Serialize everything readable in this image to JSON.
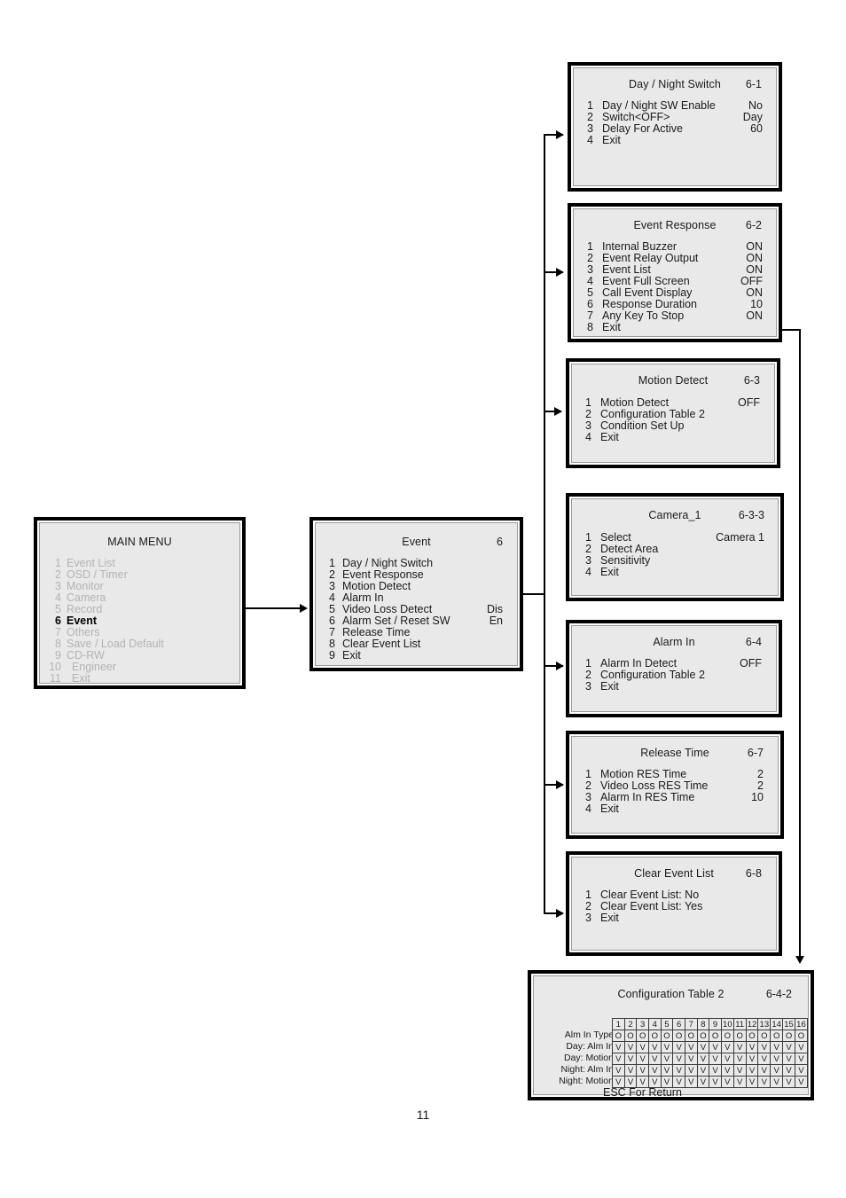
{
  "page": {
    "number": "11"
  },
  "panels": {
    "main_menu": {
      "title": "MAIN MENU",
      "code": "",
      "items": [
        {
          "num": "1",
          "label": "Event List",
          "value": "",
          "active": false
        },
        {
          "num": "2",
          "label": "OSD / Timer",
          "value": "",
          "active": false
        },
        {
          "num": "3",
          "label": "Monitor",
          "value": "",
          "active": false
        },
        {
          "num": "4",
          "label": "Camera",
          "value": "",
          "active": false
        },
        {
          "num": "5",
          "label": "Record",
          "value": "",
          "active": false
        },
        {
          "num": "6",
          "label": "Event",
          "value": "",
          "active": true
        },
        {
          "num": "7",
          "label": "Others",
          "value": "",
          "active": false
        },
        {
          "num": "8",
          "label": "Save / Load Default",
          "value": "",
          "active": false
        },
        {
          "num": "9",
          "label": "CD-RW",
          "value": "",
          "active": false
        },
        {
          "num": "10",
          "label": "Engineer",
          "value": "",
          "active": false
        },
        {
          "num": "11",
          "label": "Exit",
          "value": "",
          "active": false
        }
      ]
    },
    "event": {
      "title": "Event",
      "code": "6",
      "items": [
        {
          "num": "1",
          "label": "Day / Night Switch",
          "value": ""
        },
        {
          "num": "2",
          "label": "Event Response",
          "value": ""
        },
        {
          "num": "3",
          "label": "Motion Detect",
          "value": ""
        },
        {
          "num": "4",
          "label": "Alarm In",
          "value": ""
        },
        {
          "num": "5",
          "label": "Video Loss Detect",
          "value": "Dis"
        },
        {
          "num": "6",
          "label": "Alarm Set / Reset SW",
          "value": "En"
        },
        {
          "num": "7",
          "label": "Release Time",
          "value": ""
        },
        {
          "num": "8",
          "label": "Clear Event List",
          "value": ""
        },
        {
          "num": "9",
          "label": "Exit",
          "value": ""
        }
      ]
    },
    "day_night_switch": {
      "title": "Day / Night Switch",
      "code": "6-1",
      "items": [
        {
          "num": "1",
          "label": "Day / Night SW Enable",
          "value": "No"
        },
        {
          "num": "2",
          "label": "Switch<OFF>",
          "value": "Day"
        },
        {
          "num": "3",
          "label": "Delay For Active",
          "value": "60"
        },
        {
          "num": "4",
          "label": "Exit",
          "value": ""
        }
      ]
    },
    "event_response": {
      "title": "Event Response",
      "code": "6-2",
      "items": [
        {
          "num": "1",
          "label": "Internal Buzzer",
          "value": "ON"
        },
        {
          "num": "2",
          "label": "Event Relay Output",
          "value": "ON"
        },
        {
          "num": "3",
          "label": "Event List",
          "value": "ON"
        },
        {
          "num": "4",
          "label": "Event Full Screen",
          "value": "OFF"
        },
        {
          "num": "5",
          "label": "Call Event Display",
          "value": "ON"
        },
        {
          "num": "6",
          "label": "Response Duration",
          "value": "10"
        },
        {
          "num": "7",
          "label": "Any Key To Stop",
          "value": "ON"
        },
        {
          "num": "8",
          "label": "Exit",
          "value": ""
        }
      ]
    },
    "motion_detect": {
      "title": "Motion Detect",
      "code": "6-3",
      "items": [
        {
          "num": "1",
          "label": "Motion Detect",
          "value": "OFF"
        },
        {
          "num": "2",
          "label": "Configuration Table 2",
          "value": ""
        },
        {
          "num": "3",
          "label": "Condition Set Up",
          "value": ""
        },
        {
          "num": "4",
          "label": "Exit",
          "value": ""
        }
      ]
    },
    "camera_1": {
      "title": "Camera_1",
      "code": "6-3-3",
      "items": [
        {
          "num": "1",
          "label": "Select",
          "value": "Camera 1"
        },
        {
          "num": "2",
          "label": "Detect Area",
          "value": ""
        },
        {
          "num": "3",
          "label": "Sensitivity",
          "value": ""
        },
        {
          "num": "4",
          "label": "Exit",
          "value": ""
        }
      ]
    },
    "alarm_in": {
      "title": "Alarm In",
      "code": "6-4",
      "items": [
        {
          "num": "1",
          "label": "Alarm In Detect",
          "value": "OFF"
        },
        {
          "num": "2",
          "label": "Configuration Table 2",
          "value": ""
        },
        {
          "num": "3",
          "label": "Exit",
          "value": ""
        }
      ]
    },
    "release_time": {
      "title": "Release Time",
      "code": "6-7",
      "items": [
        {
          "num": "1",
          "label": "Motion RES Time",
          "value": "2"
        },
        {
          "num": "2",
          "label": "Video Loss RES Time",
          "value": "2"
        },
        {
          "num": "3",
          "label": "Alarm In RES Time",
          "value": "10"
        },
        {
          "num": "4",
          "label": "Exit",
          "value": ""
        }
      ]
    },
    "clear_event_list": {
      "title": "Clear Event List",
      "code": "6-8",
      "items": [
        {
          "num": "1",
          "label": "Clear Event List: No",
          "value": ""
        },
        {
          "num": "2",
          "label": "Clear Event List: Yes",
          "value": ""
        },
        {
          "num": "3",
          "label": "Exit",
          "value": ""
        }
      ]
    },
    "configuration_table_2": {
      "title": "Configuration Table 2",
      "code": "6-4-2",
      "footer": "ESC For Return",
      "columns": [
        "1",
        "2",
        "3",
        "4",
        "5",
        "6",
        "7",
        "8",
        "9",
        "10",
        "11",
        "12",
        "13",
        "14",
        "15",
        "16"
      ],
      "rows": [
        {
          "label": "Alm In Type",
          "cells": [
            "O",
            "O",
            "O",
            "O",
            "O",
            "O",
            "O",
            "O",
            "O",
            "O",
            "O",
            "O",
            "O",
            "O",
            "O",
            "O"
          ]
        },
        {
          "label": "Day: Alm In",
          "cells": [
            "V",
            "V",
            "V",
            "V",
            "V",
            "V",
            "V",
            "V",
            "V",
            "V",
            "V",
            "V",
            "V",
            "V",
            "V",
            "V"
          ]
        },
        {
          "label": "Day: Motion",
          "cells": [
            "V",
            "V",
            "V",
            "V",
            "V",
            "V",
            "V",
            "V",
            "V",
            "V",
            "V",
            "V",
            "V",
            "V",
            "V",
            "V"
          ]
        },
        {
          "label": "Night: Alm In",
          "cells": [
            "V",
            "V",
            "V",
            "V",
            "V",
            "V",
            "V",
            "V",
            "V",
            "V",
            "V",
            "V",
            "V",
            "V",
            "V",
            "V"
          ]
        },
        {
          "label": "Night: Motion",
          "cells": [
            "V",
            "V",
            "V",
            "V",
            "V",
            "V",
            "V",
            "V",
            "V",
            "V",
            "V",
            "V",
            "V",
            "V",
            "V",
            "V"
          ]
        }
      ]
    }
  }
}
